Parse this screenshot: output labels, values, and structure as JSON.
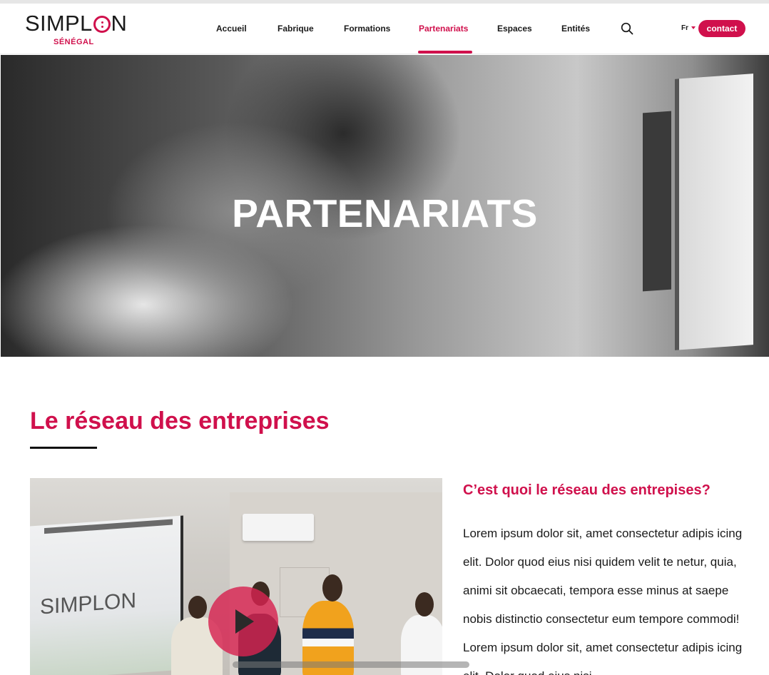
{
  "header": {
    "logo_main_left": "SIMPL",
    "logo_main_right": "N",
    "logo_sub": "SÉNÉGAL",
    "nav": [
      {
        "label": "Accueil"
      },
      {
        "label": "Fabrique"
      },
      {
        "label": "Formations"
      },
      {
        "label": "Partenariats",
        "active": true
      },
      {
        "label": "Espaces"
      },
      {
        "label": "Entités"
      }
    ],
    "search_icon": "search-icon",
    "language": "Fr",
    "contact_label": "contact"
  },
  "hero": {
    "title": "PARTENARIATS"
  },
  "section": {
    "title": "Le réseau des entreprises"
  },
  "video": {
    "screen_logo": "SIMPLON",
    "play_icon": "play-icon"
  },
  "side": {
    "heading": "C’est quoi le réseau des entrepises?",
    "body": "Lorem ipsum dolor sit, amet consectetur adipis icing elit. Dolor quod eius nisi quidem velit te netur, quia, animi sit obcaecati, tempora  esse minus at saepe nobis distinctio consectetur eum tempore commodi! Lorem ipsum dolor sit, amet consectetur adipis icing elit. Dolor quod eius nisi"
  },
  "colors": {
    "brand": "#d0104c",
    "text": "#1a1a1a"
  }
}
